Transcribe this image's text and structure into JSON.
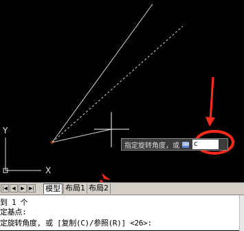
{
  "ucs": {
    "x_label": "X",
    "y_label": "Y"
  },
  "tooltip": {
    "prompt": "指定旋转角度，或",
    "key_icon": "keyboard-icon",
    "key_glyph": "⌨",
    "input_value": "c"
  },
  "tabs": {
    "nav_glyphs": [
      "|◀",
      "◀",
      "▶",
      "▶|"
    ],
    "items": [
      {
        "label": "模型",
        "active": true
      },
      {
        "label": "布局1",
        "active": false
      },
      {
        "label": "布局2",
        "active": false
      }
    ]
  },
  "command": {
    "lines": [
      "到 1 个",
      "定基点:",
      "定旋转角度, 或 [复制(C)/参照(R)] <26>:"
    ]
  },
  "colors": {
    "canvas": "#000000",
    "line": "#ffffff",
    "annotation_red": "#ff2a1a",
    "base_point": "#e06a2a"
  }
}
